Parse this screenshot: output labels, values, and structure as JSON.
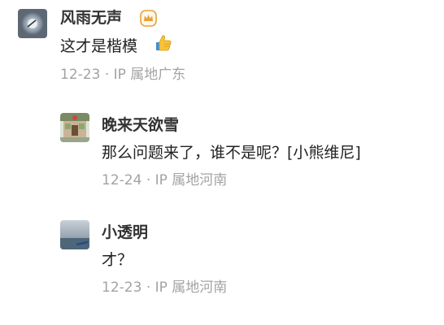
{
  "comments": [
    {
      "username": "风雨无声",
      "text": "这才是楷模",
      "emoji": "thumbs-up-icon",
      "date": "12-23",
      "ip_location": "· IP 属地广东",
      "badge": "vip-crown-badge-icon",
      "badge_color": "#e8a23a"
    },
    {
      "username": "晚来天欲雪",
      "text": "那么问题来了，谁不是呢？[小熊维尼]",
      "date": "12-24",
      "ip_location": "· IP 属地河南"
    },
    {
      "username": "小透明",
      "text": "才？",
      "date": "12-23",
      "ip_location": "· IP 属地河南"
    }
  ],
  "colors": {
    "username": "#333333",
    "text": "#222222",
    "meta": "#a3a3a3"
  }
}
